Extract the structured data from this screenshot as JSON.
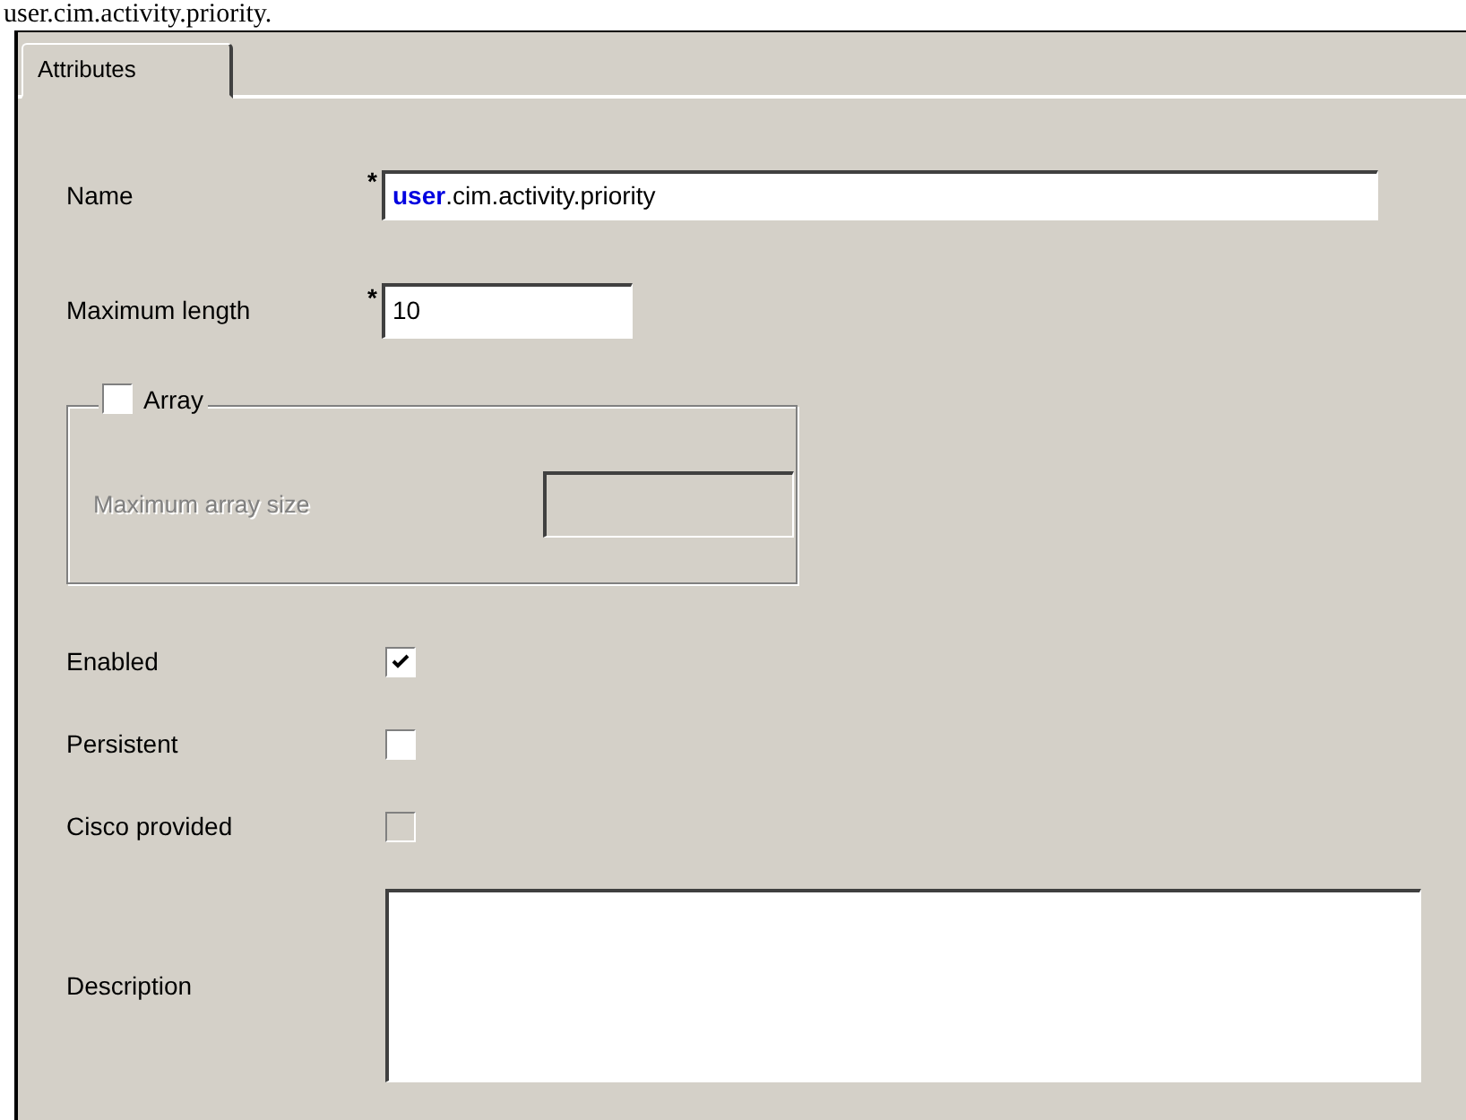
{
  "caption": "user.cim.activity.priority.",
  "tabs": [
    {
      "label": "Attributes",
      "selected": true
    }
  ],
  "fields": [
    {
      "label": "Name",
      "required_mark": "*",
      "value": "**user**.cim.activity.priority",
      "kind": "wide"
    },
    {
      "label": "Maximum length",
      "required_mark": "*",
      "value": "10",
      "kind": "short"
    }
  ],
  "array_group": {
    "label": "Array",
    "checked": false,
    "size_label": "Maximum array size",
    "disabled": true
  },
  "options": [
    {
      "label": "Enabled",
      "checked": true,
      "disabled": false
    },
    {
      "label": "Persistent",
      "checked": false,
      "disabled": false
    },
    {
      "label": "Cisco provided",
      "checked": false,
      "disabled": true
    }
  ],
  "description": {
    "label": "Description"
  }
}
